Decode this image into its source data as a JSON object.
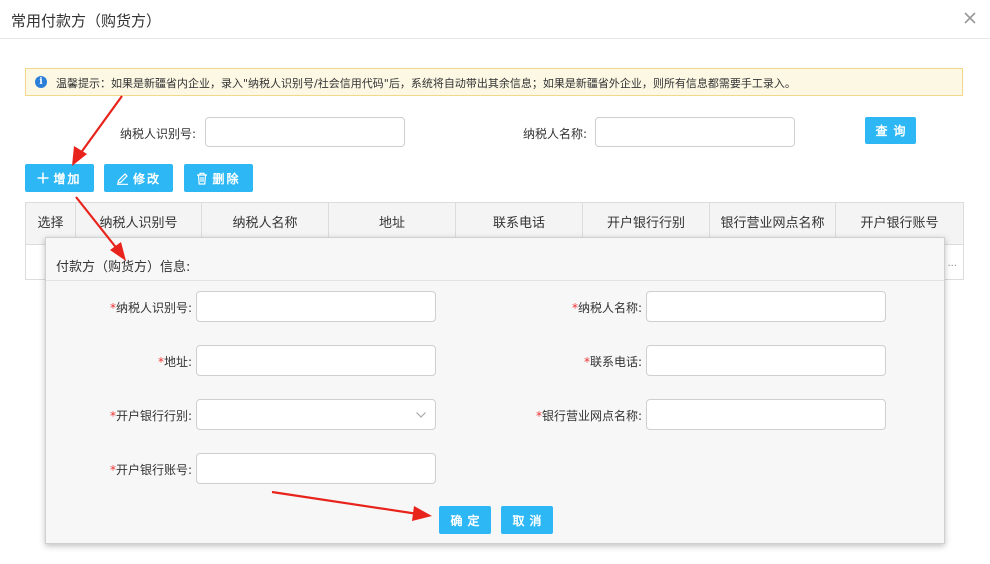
{
  "window": {
    "title": "常用付款方（购货方）"
  },
  "tip": {
    "text": "温馨提示：如果是新疆省内企业，录入\"纳税人识别号/社会信用代码\"后，系统将自动带出其余信息；如果是新疆省外企业，则所有信息都需要手工录入。"
  },
  "search": {
    "taxid_label": "纳税人识别号:",
    "taxid_value": "",
    "name_label": "纳税人名称:",
    "name_value": "",
    "query_button": "查询"
  },
  "toolbar": {
    "add": "增加",
    "edit": "修改",
    "delete": "删除"
  },
  "table": {
    "columns": [
      "选择",
      "纳税人识别号",
      "纳税人名称",
      "地址",
      "联系电话",
      "开户银行行别",
      "银行营业网点名称",
      "开户银行账号"
    ],
    "overflow": "..."
  },
  "dialog": {
    "title": "付款方（购货方）信息:",
    "required_mark": "*",
    "fields": {
      "taxid": {
        "label": "纳税人识别号:",
        "value": ""
      },
      "name": {
        "label": "纳税人名称:",
        "value": ""
      },
      "address": {
        "label": "地址:",
        "value": ""
      },
      "phone": {
        "label": "联系电话:",
        "value": ""
      },
      "bank_type": {
        "label": "开户银行行别:",
        "value": ""
      },
      "branch": {
        "label": "银行营业网点名称:",
        "value": ""
      },
      "account": {
        "label": "开户银行账号:",
        "value": ""
      }
    },
    "confirm": "确定",
    "cancel": "取消"
  },
  "colors": {
    "accent": "#2db7f5",
    "annotation_arrow": "#e8231b",
    "required": "#ee3333"
  },
  "icons": {
    "close": "close-icon",
    "info": "info-icon",
    "add": "plus-icon",
    "edit": "pencil-icon",
    "delete": "trash-icon",
    "dropdown": "chevron-down-icon"
  }
}
